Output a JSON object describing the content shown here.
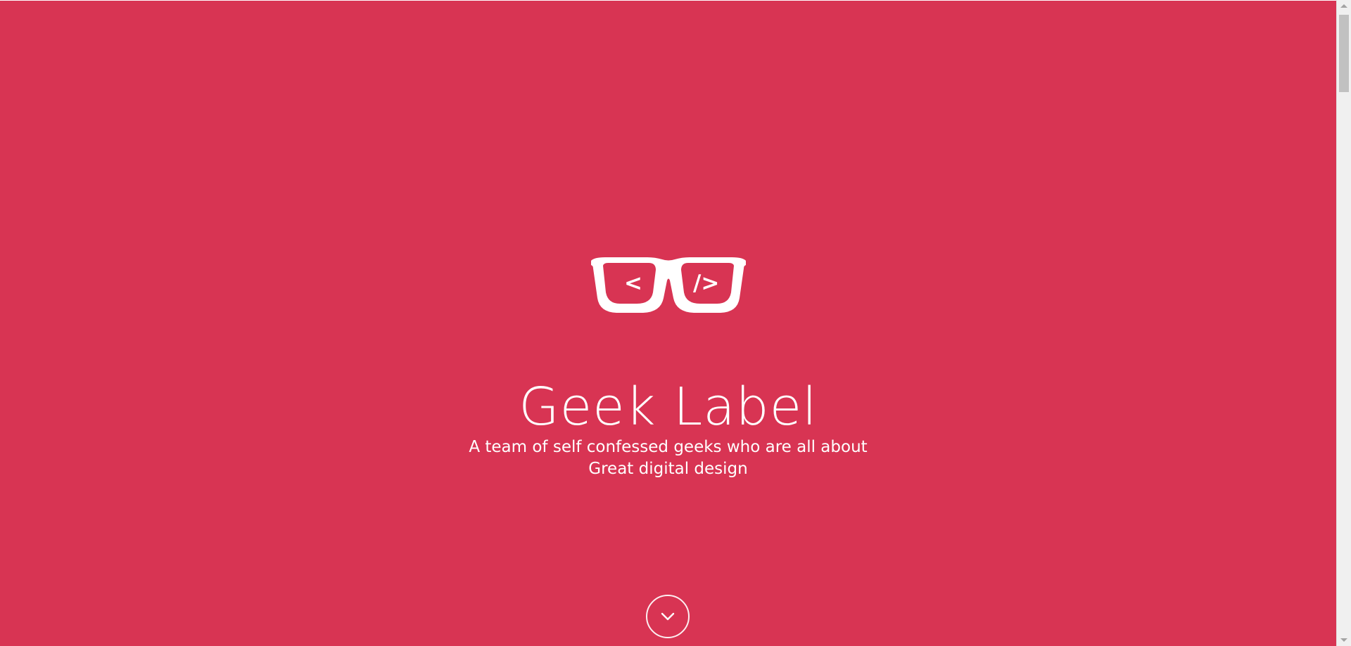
{
  "hero": {
    "title": "Geek Label",
    "tagline_line1": "A team of self confessed geeks who are all about",
    "tagline_line2": "Great digital design",
    "logo": {
      "icon": "glasses-code-icon",
      "left_symbol": "<",
      "right_symbol": "/>"
    },
    "scroll_icon": "chevron-down-icon"
  },
  "colors": {
    "background": "#d83453",
    "foreground": "#ffffff"
  }
}
